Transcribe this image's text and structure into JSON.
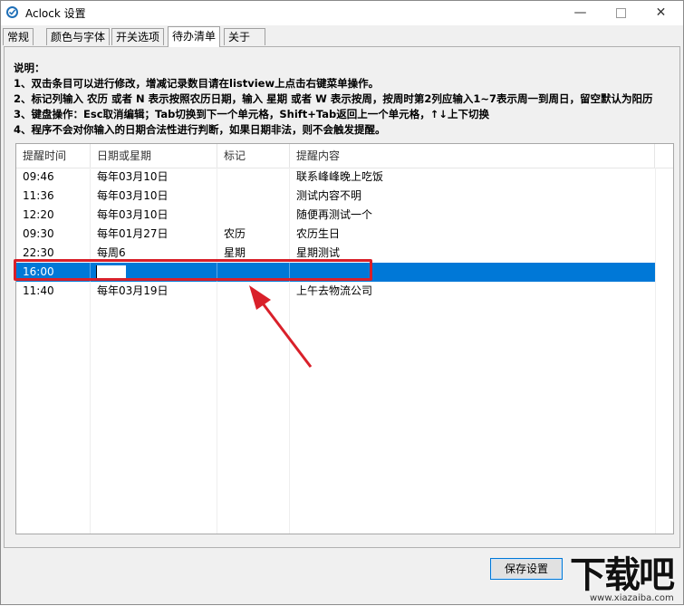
{
  "window": {
    "title": "Aclock 设置",
    "min_glyph": "—",
    "close_glyph": "✕"
  },
  "tabs": [
    {
      "label": "常规",
      "active": false
    },
    {
      "label": "颜色与字体",
      "active": false
    },
    {
      "label": "开关选项",
      "active": false
    },
    {
      "label": "待办清单",
      "active": true
    },
    {
      "label": "关于",
      "active": false
    }
  ],
  "instructions": {
    "heading": "说明：",
    "lines": [
      "1、双击条目可以进行修改，增减记录数目请在listview上点击右键菜单操作。",
      "2、标记列输入 农历 或者 N 表示按照农历日期，输入 星期 或者 W 表示按周，按周时第2列应输入1~7表示周一到周日，留空默认为阳历",
      "3、键盘操作：Esc取消编辑；Tab切换到下一个单元格，Shift+Tab返回上一个单元格，↑↓上下切换",
      "4、程序不会对你输入的日期合法性进行判断，如果日期非法，则不会触发提醒。"
    ]
  },
  "listview": {
    "columns": [
      "提醒时间",
      "日期或星期",
      "标记",
      "提醒内容"
    ],
    "rows": [
      {
        "time": "09:46",
        "date": "每年03月10日",
        "mark": "",
        "content": "联系峰峰晚上吃饭",
        "selected": false
      },
      {
        "time": "11:36",
        "date": "每年03月10日",
        "mark": "",
        "content": "测试内容不明",
        "selected": false
      },
      {
        "time": "12:20",
        "date": "每年03月10日",
        "mark": "",
        "content": "随便再测试一个",
        "selected": false
      },
      {
        "time": "09:30",
        "date": "每年01月27日",
        "mark": "农历",
        "content": "农历生日",
        "selected": false
      },
      {
        "time": "22:30",
        "date": "每周6",
        "mark": "星期",
        "content": "星期测试",
        "selected": false
      },
      {
        "time": "16:00",
        "date": "",
        "mark": "",
        "content": "",
        "selected": true
      },
      {
        "time": "11:40",
        "date": "每年03月19日",
        "mark": "",
        "content": "上午去物流公司",
        "selected": false
      }
    ]
  },
  "footer": {
    "save_label": "保存设置"
  },
  "watermark": {
    "main": "下载吧",
    "sub": "www.xiazaiba.com"
  },
  "colors": {
    "selection": "#0078d7",
    "annotation": "#d9202a"
  }
}
